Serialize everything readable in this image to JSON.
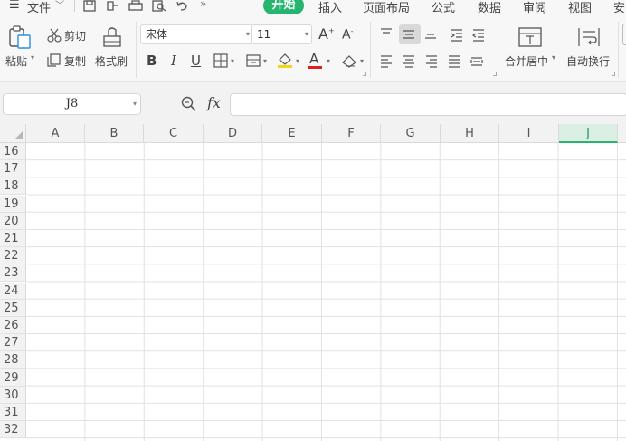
{
  "menu": {
    "hamburger": "☰",
    "file_label": "文件",
    "tabs": [
      "开始",
      "插入",
      "页面布局",
      "公式",
      "数据",
      "审阅",
      "视图",
      "安"
    ],
    "active_tab": "开始"
  },
  "ribbon": {
    "paste_label": "粘贴",
    "cut_label": "剪切",
    "copy_label": "复制",
    "format_painter_label": "格式刷",
    "font_name": "宋体",
    "font_size": "11",
    "merge_center_label": "合并居中",
    "wrap_text_label": "自动换行"
  },
  "formula_bar": {
    "cell_reference": "J8",
    "fx_label": "fx",
    "formula_value": ""
  },
  "grid": {
    "columns": [
      "A",
      "B",
      "C",
      "D",
      "E",
      "F",
      "G",
      "H",
      "I",
      "J"
    ],
    "selected_column": "J",
    "rows": [
      "16",
      "17",
      "18",
      "19",
      "20",
      "21",
      "22",
      "23",
      "24",
      "25",
      "26",
      "27",
      "28",
      "29",
      "30",
      "31",
      "32"
    ]
  },
  "colors": {
    "accent": "#25b56e",
    "ribbon_bg": "#f7f7f7",
    "header_bg": "#f2f2f2"
  }
}
